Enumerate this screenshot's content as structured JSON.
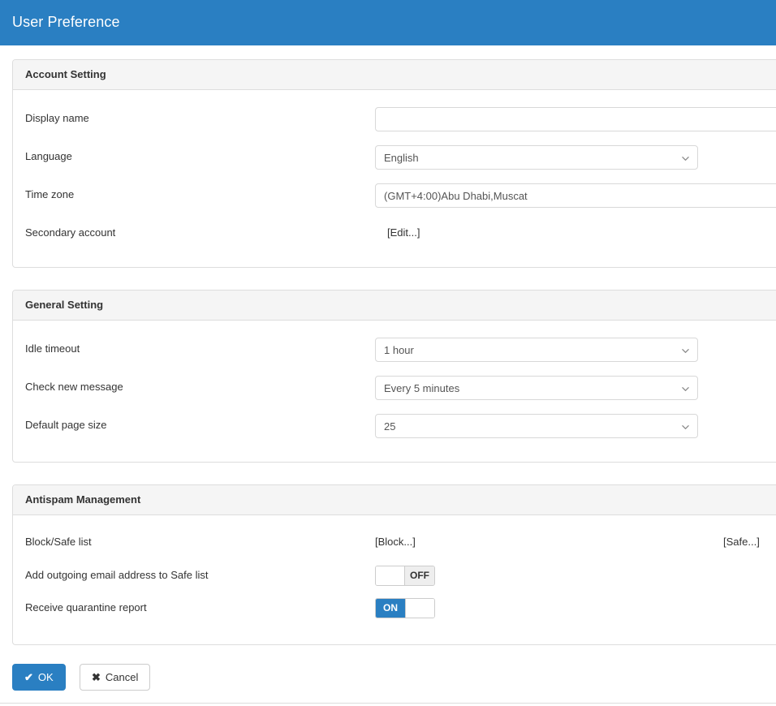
{
  "window": {
    "title": "User Preference",
    "accent_color": "#2a7fc2",
    "panel_header_bg": "#f5f5f5",
    "border_color": "#dddddd"
  },
  "sections": [
    {
      "id": "account-setting",
      "title": "Account Setting",
      "rows": [
        {
          "label": "Display name",
          "control": "text",
          "value": "",
          "placeholder": ""
        },
        {
          "label": "Language",
          "control": "select",
          "value": "English"
        },
        {
          "label": "Time zone",
          "control": "select",
          "value": "(GMT+4:00)Abu Dhabi,Muscat"
        },
        {
          "label": "Secondary account",
          "control": "link",
          "value": "[Edit...]"
        }
      ]
    },
    {
      "id": "general-setting",
      "title": "General Setting",
      "rows": [
        {
          "label": "Idle timeout",
          "control": "select",
          "value": "1 hour"
        },
        {
          "label": "Check new message",
          "control": "select",
          "value": "Every 5 minutes"
        },
        {
          "label": "Default page size",
          "control": "select",
          "value": "25"
        }
      ]
    },
    {
      "id": "antispam-management",
      "title": "Antispam Management",
      "rows": [
        {
          "label": "Block/Safe list",
          "control": "links",
          "value": "[Block...]",
          "value2": "[Safe...]"
        },
        {
          "label": "Add outgoing email address to Safe list",
          "control": "toggle",
          "state": "OFF"
        },
        {
          "label": "Receive quarantine report",
          "control": "toggle",
          "state": "ON"
        }
      ]
    }
  ],
  "footer": {
    "ok_label": "OK",
    "ok_glyph": "✔",
    "cancel_label": "Cancel",
    "cancel_glyph": "✖"
  }
}
